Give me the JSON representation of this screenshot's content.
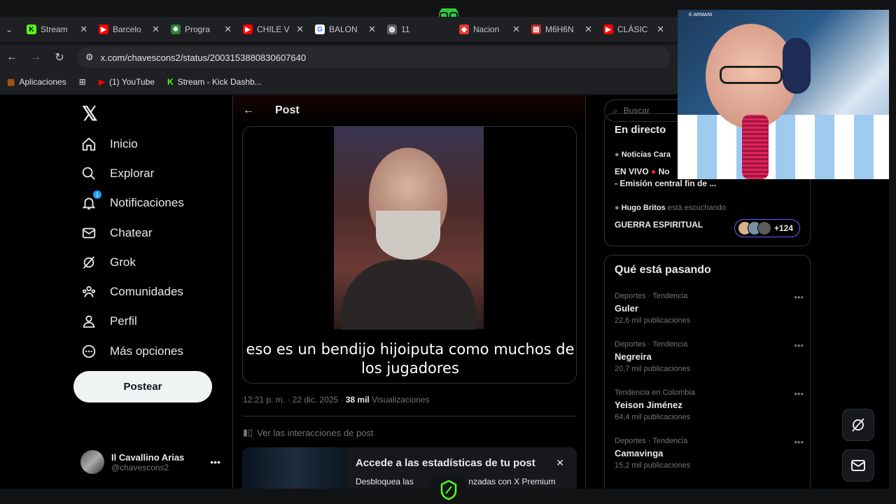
{
  "browser": {
    "tabs": [
      {
        "title": "Stream",
        "color": "#53fc18",
        "glyph": "K"
      },
      {
        "title": "Barcelo",
        "color": "#ff0000",
        "glyph": "▶"
      },
      {
        "title": "Progra",
        "color": "#2e7d32",
        "glyph": "✸"
      },
      {
        "title": "CHILE V",
        "color": "#ff0000",
        "glyph": "▶"
      },
      {
        "title": "BALON",
        "color": "#4285f4",
        "glyph": "G"
      },
      {
        "title": "11",
        "color": "#9aa0a6",
        "glyph": "◍"
      },
      {
        "title": "Nacion",
        "color": "#e53935",
        "glyph": "◆"
      },
      {
        "title": "M6H6N",
        "color": "#c62828",
        "glyph": "▤"
      },
      {
        "title": "CLÁSIC",
        "color": "#ff0000",
        "glyph": "▶"
      }
    ],
    "url": "x.com/chavescons2/status/2003153880830607640",
    "bookmarks": [
      {
        "label": "Aplicaciones"
      },
      {
        "label": "(1) YouTube"
      },
      {
        "label": "Stream - Kick Dashb..."
      }
    ]
  },
  "nav": {
    "items": [
      {
        "label": "Inicio",
        "icon": "home-icon"
      },
      {
        "label": "Explorar",
        "icon": "search-icon"
      },
      {
        "label": "Notificaciones",
        "icon": "bell-icon",
        "badge": "1"
      },
      {
        "label": "Chatear",
        "icon": "mail-icon"
      },
      {
        "label": "Grok",
        "icon": "grok-icon"
      },
      {
        "label": "Comunidades",
        "icon": "people-icon"
      },
      {
        "label": "Perfil",
        "icon": "person-icon"
      },
      {
        "label": "Más opciones",
        "icon": "more-icon"
      }
    ],
    "post_button": "Postear",
    "account": {
      "name": "Il Cavallino Arias",
      "handle": "@chavescons2"
    }
  },
  "post": {
    "header": "Post",
    "subtitle_line1": "eso es un bendijo hijoiputa como muchos de",
    "subtitle_line2": "los jugadores",
    "time": "12:21 p. m. · 22 dic. 2025 · ",
    "views_count": "38 mil",
    "views_label": " Visualizaciones",
    "interactions": "Ver las interacciones de post",
    "promo_title": "Accede a las estadísticas de tu post",
    "promo_sub_left": "Desbloquea las",
    "promo_sub_right": "nzadas con X Premium"
  },
  "sidebar": {
    "search_placeholder": "Buscar",
    "live_title": "En directo",
    "live1_source": "Noticias Cara",
    "live1_title_a": "EN VIVO",
    "live1_title_b": "No",
    "live1_title_c": "- Emisión central fin de ...",
    "live2_user": "Hugo Britos",
    "live2_status": "está escuchando",
    "live2_title": "GUERRA ESPIRITUAL",
    "live2_listeners": "+124",
    "trends_title": "Qué está pasando",
    "trends": [
      {
        "category": "Deportes · Tendencia",
        "name": "Guler",
        "count": "22,6 mil publicaciones"
      },
      {
        "category": "Deportes · Tendencia",
        "name": "Negreira",
        "count": "20,7 mil publicaciones"
      },
      {
        "category": "Tendencia en Colombia",
        "name": "Yeison Jiménez",
        "count": "64,4 mil publicaciones"
      },
      {
        "category": "Deportes · Tendencia",
        "name": "Camavinga",
        "count": "15,2 mil publicaciones"
      }
    ]
  },
  "webcam": {
    "label": "E ARMANI"
  }
}
